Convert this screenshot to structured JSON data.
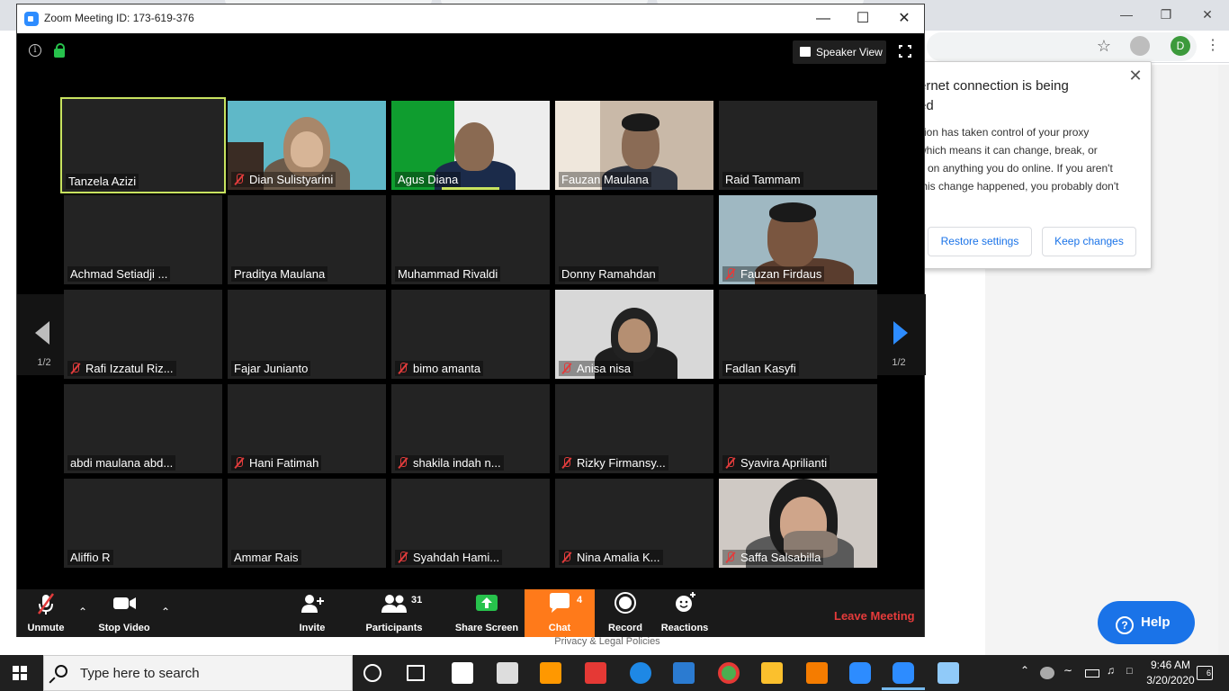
{
  "zoom": {
    "window_title": "Zoom Meeting ID: 173-619-376",
    "speaker_view_label": "Speaker View",
    "page_indicator_left": "1/2",
    "page_indicator_right": "1/2",
    "participants": [
      {
        "name": "Tanzela Azizi",
        "muted": false,
        "video": false,
        "active": true
      },
      {
        "name": "Dian Sulistyarini",
        "muted": true,
        "video": true
      },
      {
        "name": "Agus Diana",
        "muted": false,
        "video": true,
        "speaking": true
      },
      {
        "name": "Fauzan Maulana",
        "muted": false,
        "video": true
      },
      {
        "name": "Raid Tammam",
        "muted": false,
        "video": false
      },
      {
        "name": "Achmad Setiadji ...",
        "muted": false,
        "video": false
      },
      {
        "name": "Praditya Maulana",
        "muted": false,
        "video": false
      },
      {
        "name": "Muhammad Rivaldi",
        "muted": false,
        "video": false
      },
      {
        "name": "Donny Ramahdan",
        "muted": false,
        "video": false
      },
      {
        "name": "Fauzan Firdaus",
        "muted": true,
        "video": true
      },
      {
        "name": "Rafi Izzatul Riz...",
        "muted": true,
        "video": false
      },
      {
        "name": "Fajar Junianto",
        "muted": false,
        "video": false
      },
      {
        "name": "bimo amanta",
        "muted": true,
        "video": false
      },
      {
        "name": "Anisa nisa",
        "muted": true,
        "video": true
      },
      {
        "name": "Fadlan Kasyfi",
        "muted": false,
        "video": false
      },
      {
        "name": "abdi maulana abd...",
        "muted": false,
        "video": false
      },
      {
        "name": "Hani Fatimah",
        "muted": true,
        "video": false
      },
      {
        "name": "shakila indah n...",
        "muted": true,
        "video": false
      },
      {
        "name": "Rizky Firmansy...",
        "muted": true,
        "video": false
      },
      {
        "name": "Syavira Aprilianti",
        "muted": true,
        "video": false
      },
      {
        "name": "Aliffio R",
        "muted": false,
        "video": false
      },
      {
        "name": "Ammar Rais",
        "muted": false,
        "video": false
      },
      {
        "name": "Syahdah Hami...",
        "muted": true,
        "video": false
      },
      {
        "name": "Nina Amalia K...",
        "muted": true,
        "video": false
      },
      {
        "name": "Saffa Salsabilla",
        "muted": true,
        "video": true
      }
    ],
    "toolbar": {
      "unmute": "Unmute",
      "stop_video": "Stop Video",
      "invite": "Invite",
      "participants": "Participants",
      "participants_count": "31",
      "share_screen": "Share Screen",
      "chat": "Chat",
      "chat_count": "4",
      "record": "Record",
      "reactions": "Reactions",
      "leave": "Leave Meeting"
    }
  },
  "browser": {
    "popup_title_line1": "ernet connection is being",
    "popup_title_line2": "ed",
    "popup_body_lines": [
      "sion has taken control of your proxy",
      "which means it can change, break, or",
      "p on anything you do online. If you aren't",
      "this change happened, you probably don't"
    ],
    "restore_label": "Restore settings",
    "keep_label": "Keep changes",
    "profile_initial": "D",
    "privacy_link": "Privacy & Legal Policies",
    "help_label": "Help"
  },
  "taskbar": {
    "search_placeholder": "Type here to search",
    "time": "9:46 AM",
    "date": "3/20/2020",
    "notification_count": "6"
  },
  "colors": {
    "zoom_blue": "#2d8cff",
    "chat_orange": "#ff7a1a",
    "leave_red": "#e53b3b",
    "active_speaker": "#c8e35f",
    "help_blue": "#1a73e8"
  }
}
